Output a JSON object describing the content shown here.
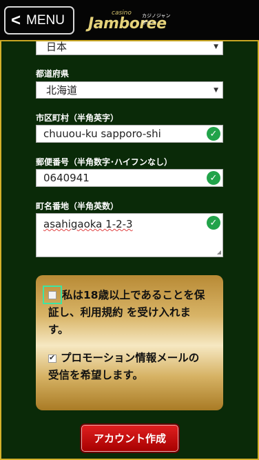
{
  "header": {
    "menu_label": "MENU",
    "logo_small": "casino",
    "logo_main": "Jamboree",
    "logo_sub": "カジノジャンボリー"
  },
  "form": {
    "country": {
      "value": "日本"
    },
    "prefecture": {
      "label": "都道府県",
      "value": "北海道"
    },
    "city": {
      "label": "市区町村（半角英字）",
      "value": "chuuou-ku sapporo-shi"
    },
    "postal": {
      "label": "郵便番号（半角数字･ハイフンなし）",
      "value": "0640941"
    },
    "street": {
      "label": "町名番地（半角英数）",
      "value": "asahigaoka 1-2-3"
    }
  },
  "consent": {
    "age_line1": "私は18歳以上であることを保",
    "age_line2": "証し、利用規約 を受け入れま",
    "age_line3": "す。",
    "age_checked": false,
    "promo_line1": "プロモーション情報メールの",
    "promo_line2": "受信を希望します。",
    "promo_checked": true
  },
  "submit_label": "アカウント作成",
  "colors": {
    "accent": "#22a34a",
    "button": "#c00000",
    "background": "#0a2a08"
  }
}
